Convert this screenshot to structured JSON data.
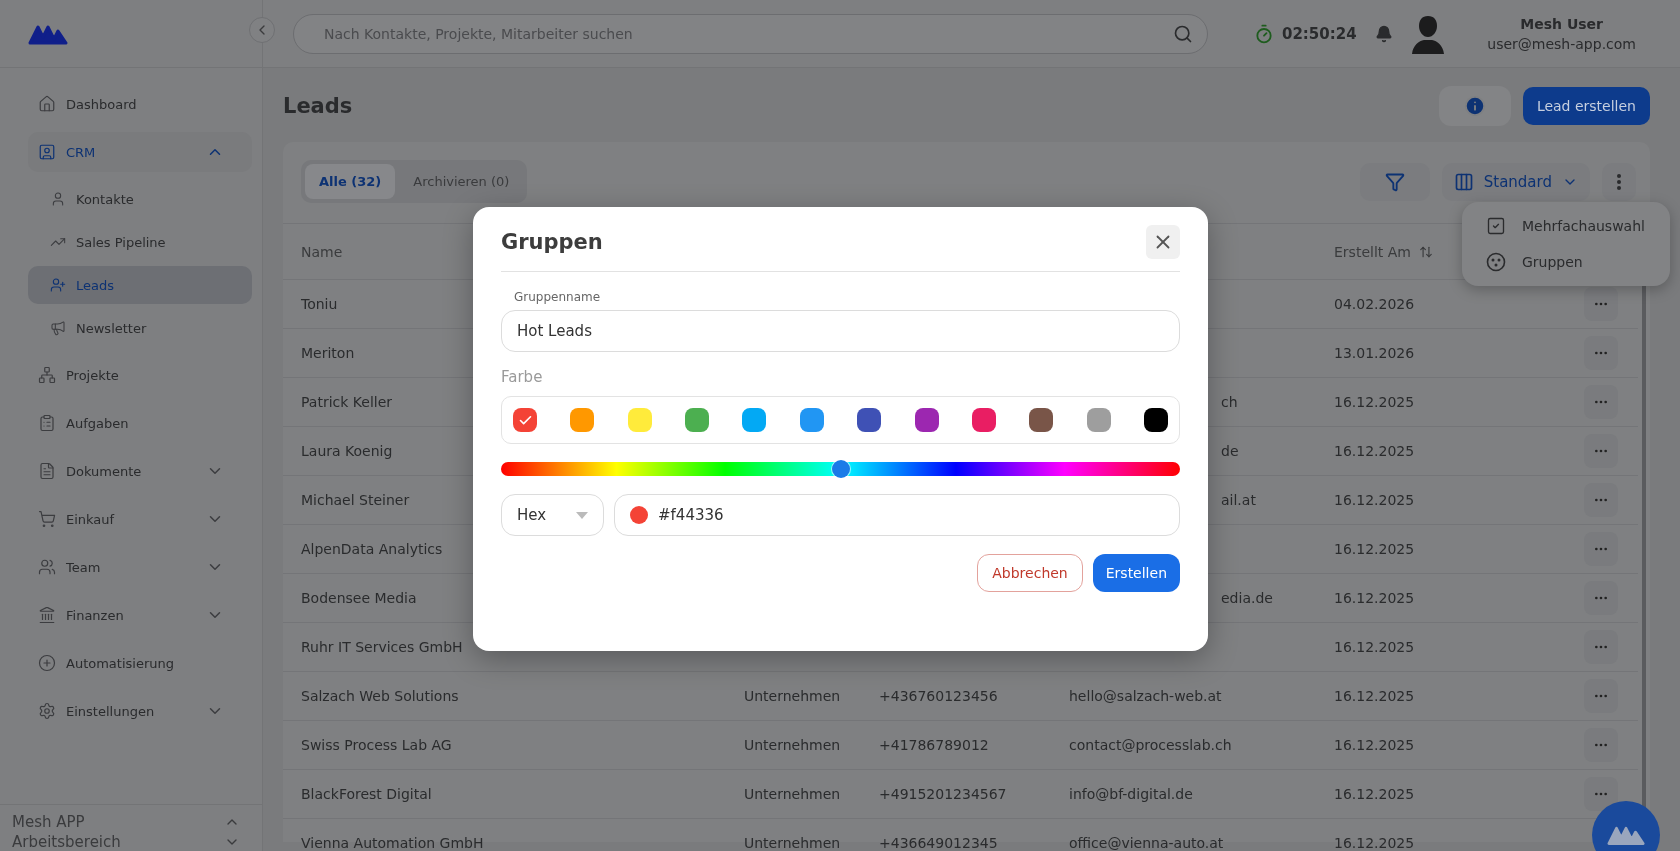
{
  "sidebar": {
    "items": [
      {
        "label": "Dashboard",
        "selected": false
      },
      {
        "label": "CRM",
        "selected": false,
        "expanded": true,
        "children": [
          {
            "label": "Kontakte",
            "selected": false
          },
          {
            "label": "Sales Pipeline",
            "selected": false
          },
          {
            "label": "Leads",
            "selected": true
          },
          {
            "label": "Newsletter",
            "selected": false
          }
        ]
      },
      {
        "label": "Projekte",
        "selected": false
      },
      {
        "label": "Aufgaben",
        "selected": false
      },
      {
        "label": "Dokumente",
        "selected": false,
        "expanded": false
      },
      {
        "label": "Einkauf",
        "selected": false,
        "expanded": false
      },
      {
        "label": "Team",
        "selected": false,
        "expanded": false
      },
      {
        "label": "Finanzen",
        "selected": false,
        "expanded": false
      },
      {
        "label": "Automatisierung",
        "selected": false
      },
      {
        "label": "Einstellungen",
        "selected": false,
        "expanded": false
      }
    ],
    "workspace": {
      "app": "Mesh APP",
      "label": "Arbeitsbereich"
    }
  },
  "topbar": {
    "search": {
      "placeholder": "Nach Kontakte, Projekte, Mitarbeiter suchen"
    },
    "timer": "02:50:24",
    "user": {
      "name": "Mesh User",
      "email": "user@mesh-app.com"
    }
  },
  "page": {
    "title": "Leads",
    "create_button": "Lead erstellen"
  },
  "tabs": [
    {
      "label": "Alle (32)",
      "selected": true
    },
    {
      "label": "Archivieren (0)",
      "selected": false
    }
  ],
  "view_select": "Standard",
  "menu": {
    "items": [
      {
        "label": "Mehrfachauswahl"
      },
      {
        "label": "Gruppen"
      }
    ]
  },
  "table": {
    "columns": {
      "name": "Name",
      "created": "Erstellt Am"
    },
    "rows": [
      {
        "name": "Toniu",
        "created": "04.02.2026"
      },
      {
        "name": "Meriton",
        "created": "13.01.2026"
      },
      {
        "name": "Patrick Keller",
        "email": "ch",
        "created": "16.12.2025"
      },
      {
        "name": "Laura Koenig",
        "email": "de",
        "created": "16.12.2025"
      },
      {
        "name": "Michael Steiner",
        "email": "ail.at",
        "created": "16.12.2025"
      },
      {
        "name": "AlpenData Analytics",
        "created": "16.12.2025"
      },
      {
        "name": "Bodensee Media",
        "email": "edia.de",
        "created": "16.12.2025"
      },
      {
        "name": "Ruhr IT Services GmbH",
        "created": "16.12.2025"
      },
      {
        "name": "Salzach Web Solutions",
        "type": "Unternehmen",
        "phone": "+436760123456",
        "email": "hello@salzach-web.at",
        "created": "16.12.2025"
      },
      {
        "name": "Swiss Process Lab AG",
        "type": "Unternehmen",
        "phone": "+41786789012",
        "email": "contact@processlab.ch",
        "created": "16.12.2025"
      },
      {
        "name": "BlackForest Digital",
        "type": "Unternehmen",
        "phone": "+4915201234567",
        "email": "info@bf-digital.de",
        "created": "16.12.2025"
      },
      {
        "name": "Vienna Automation GmbH",
        "type": "Unternehmen",
        "phone": "+436649012345",
        "email": "office@vienna-auto.at",
        "created": "16.12.2025"
      }
    ]
  },
  "dialog": {
    "title": "Gruppen",
    "name_label": "Gruppenname",
    "name_value": "Hot Leads",
    "color_label": "Farbe",
    "swatches": [
      {
        "color": "#f44336",
        "selected": true
      },
      {
        "color": "#ff9800",
        "selected": false
      },
      {
        "color": "#ffeb3b",
        "selected": false
      },
      {
        "color": "#4caf50",
        "selected": false
      },
      {
        "color": "#03a9f4",
        "selected": false
      },
      {
        "color": "#2196f3",
        "selected": false
      },
      {
        "color": "#3f51b5",
        "selected": false
      },
      {
        "color": "#9c27b0",
        "selected": false
      },
      {
        "color": "#e91e63",
        "selected": false
      },
      {
        "color": "#795548",
        "selected": false
      },
      {
        "color": "#9e9e9e",
        "selected": false
      },
      {
        "color": "#000000",
        "selected": false
      }
    ],
    "hue": {
      "level": 0.5
    },
    "format": "Hex",
    "hex_value": "#f44336",
    "cancel_button": "Abbrechen",
    "create_button": "Erstellen"
  }
}
